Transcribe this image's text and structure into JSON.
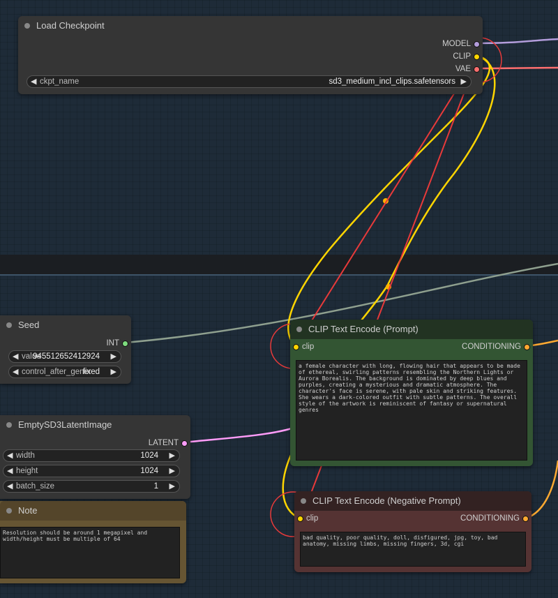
{
  "nodes": {
    "load_checkpoint": {
      "title": "Load Checkpoint",
      "outputs": [
        "MODEL",
        "CLIP",
        "VAE"
      ],
      "ckpt_label": "ckpt_name",
      "ckpt_value": "sd3_medium_incl_clips.safetensors"
    },
    "seed": {
      "title": "Seed",
      "output": "INT",
      "value_label": "value",
      "value": "945512652412924",
      "control_label": "control_after_generate",
      "control_value": "fixed"
    },
    "latent": {
      "title": "EmptySD3LatentImage",
      "output": "LATENT",
      "width_label": "width",
      "width_value": "1024",
      "height_label": "height",
      "height_value": "1024",
      "batch_label": "batch_size",
      "batch_value": "1"
    },
    "note": {
      "title": "Note",
      "text": "Resolution should be around 1 megapixel and\nwidth/height must be multiple of 64"
    },
    "clip_pos": {
      "title": "CLIP Text Encode (Prompt)",
      "input": "clip",
      "output": "CONDITIONING",
      "text": "a female character with long, flowing hair that appears to be made of ethereal, swirling patterns resembling the Northern Lights or Aurora Borealis. The background is dominated by deep blues and purples, creating a mysterious and dramatic atmosphere. The character's face is serene, with pale skin and striking features. She wears a dark-colored outfit with subtle patterns. The overall style of the artwork is reminiscent of fantasy or supernatural genres"
    },
    "clip_neg": {
      "title": "CLIP Text Encode (Negative Prompt)",
      "input": "clip",
      "output": "CONDITIONING",
      "text": "bad quality, poor quality, doll, disfigured, jpg, toy, bad anatomy, missing limbs, missing fingers, 3d, cgi"
    }
  },
  "colors": {
    "model": "#b39ddb",
    "clip": "#ffd500",
    "vae": "#ff6e6e",
    "int": "#7edb7e",
    "latent": "#ff9cf9",
    "conditioning": "#ffa931",
    "annotation": "#e83a3a"
  }
}
